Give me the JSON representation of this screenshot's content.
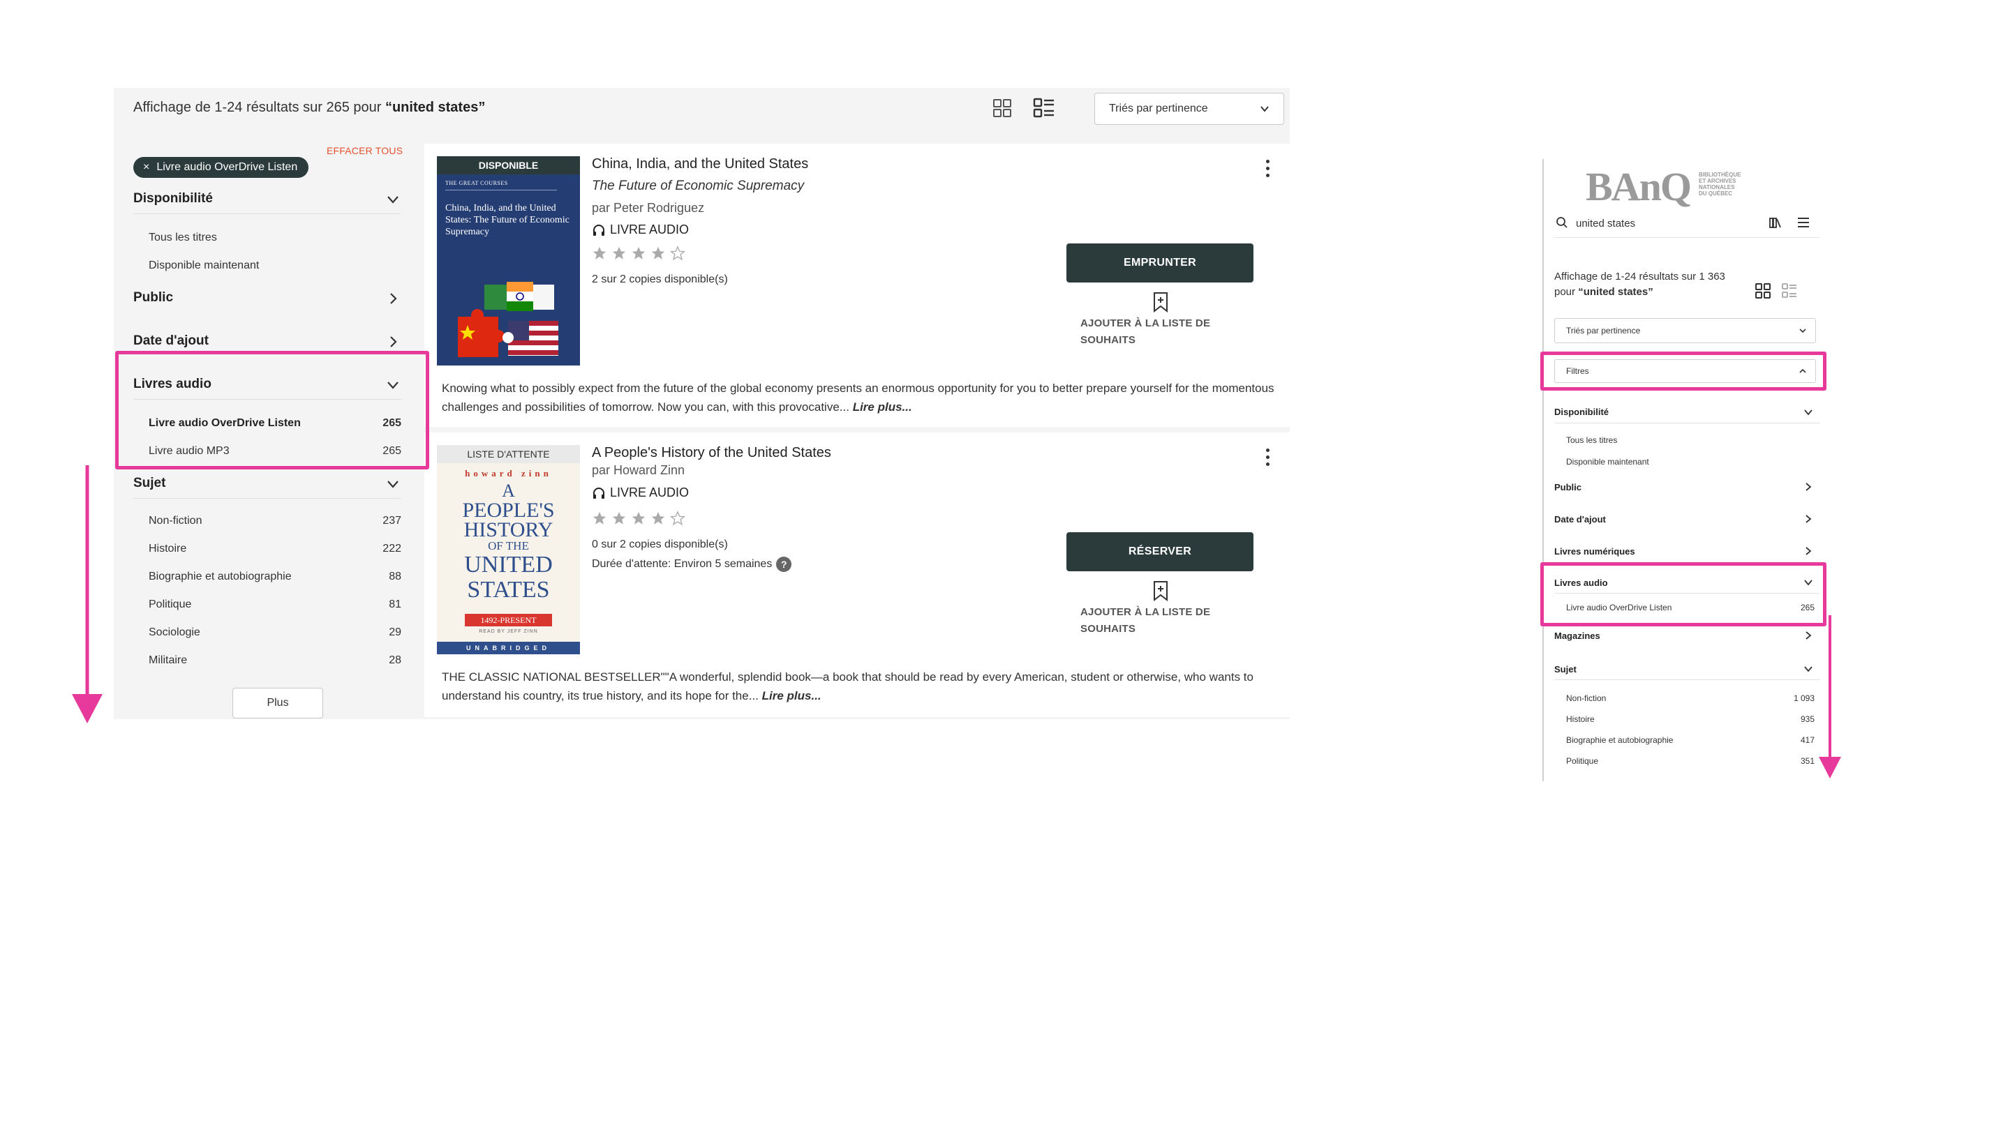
{
  "desktop": {
    "results_text": "Affichage de 1-24 résultats sur 265 pour ",
    "query_text": "“united states”",
    "sort_label": "Triés par pertinence",
    "active_filter": "Livre audio OverDrive Listen",
    "active_filter_remove": "×",
    "clear_all": "EFFACER TOUS",
    "sidebar": {
      "availability": {
        "title": "Disponibilité",
        "options": [
          "Tous les titres",
          "Disponible maintenant"
        ]
      },
      "audience": {
        "title": "Public"
      },
      "date_added": {
        "title": "Date d'ajout"
      },
      "audiobooks": {
        "title": "Livres audio",
        "options": [
          {
            "label": "Livre audio OverDrive Listen",
            "count": "265"
          },
          {
            "label": "Livre audio MP3",
            "count": "265"
          }
        ]
      },
      "subject": {
        "title": "Sujet",
        "options": [
          {
            "label": "Non-fiction",
            "count": "237"
          },
          {
            "label": "Histoire",
            "count": "222"
          },
          {
            "label": "Biographie et autobiographie",
            "count": "88"
          },
          {
            "label": "Politique",
            "count": "81"
          },
          {
            "label": "Sociologie",
            "count": "29"
          },
          {
            "label": "Militaire",
            "count": "28"
          }
        ]
      },
      "more_button": "Plus"
    },
    "books": [
      {
        "status": "DISPONIBLE",
        "cover_title": "China, India, and the United States: The Future of Economic Supremacy",
        "cover_publisher": "THE GREAT COURSES",
        "title": "China, India, and the United States",
        "subtitle": "The Future of Economic Supremacy",
        "author": "par Peter Rodriguez",
        "format": "LIVRE AUDIO",
        "rating": 4,
        "copies": "2 sur 2 copies disponible(s)",
        "action": "EMPRUNTER",
        "wishlist": "AJOUTER À LA LISTE DE SOUHAITS",
        "description": "Knowing what to possibly expect from the future of the global economy presents an enormous opportunity for you to better prepare yourself for the momentous challenges and possibilities of tomorrow. Now you can, with this provocative...",
        "read_more": "Lire plus..."
      },
      {
        "status": "LISTE D'ATTENTE",
        "cover_author": "howard zinn",
        "cover_lines": [
          "A",
          "PEOPLE'S",
          "HISTORY",
          "OF THE",
          "UNITED",
          "STATES"
        ],
        "cover_years": "1492-PRESENT",
        "cover_reader": "READ BY JEFF ZINN",
        "cover_footer": "UNABRIDGED",
        "title": "A People's History of the United States",
        "author": "par Howard Zinn",
        "format": "LIVRE AUDIO",
        "rating": 4,
        "copies": "0 sur 2 copies disponible(s)",
        "wait": "Durée d'attente: Environ 5 semaines",
        "wait_help": "?",
        "action": "RÉSERVER",
        "wishlist": "AJOUTER À LA LISTE DE SOUHAITS",
        "description": "THE CLASSIC NATIONAL BESTSELLER\"\"A wonderful, splendid book—a book that should be read by every American, student or otherwise, who wants to understand his country, its true history, and its hope for the...",
        "read_more": "Lire plus..."
      }
    ]
  },
  "mobile": {
    "logo_text": "BAnQ",
    "logo_sub": [
      "BIBLIOTHÈQUE",
      "ET ARCHIVES",
      "NATIONALES",
      "DU QUÉBEC"
    ],
    "search_value": "united states",
    "results_text": "Affichage de 1-24 résultats sur 1 363",
    "results_query_prefix": "pour ",
    "query_text": "“united states”",
    "sort_label": "Triés par pertinence",
    "filters_label": "Filtres",
    "availability": {
      "title": "Disponibilité",
      "options": [
        "Tous les titres",
        "Disponible maintenant"
      ]
    },
    "audience": "Public",
    "date_added": "Date d'ajout",
    "digital_books": "Livres numériques",
    "audiobooks": {
      "title": "Livres audio",
      "options": [
        {
          "label": "Livre audio OverDrive Listen",
          "count": "265"
        }
      ]
    },
    "magazines": "Magazines",
    "subject": {
      "title": "Sujet",
      "options": [
        {
          "label": "Non-fiction",
          "count": "1 093"
        },
        {
          "label": "Histoire",
          "count": "935"
        },
        {
          "label": "Biographie et autobiographie",
          "count": "417"
        },
        {
          "label": "Politique",
          "count": "351"
        }
      ]
    }
  },
  "colors": {
    "highlight": "#e6399b",
    "button_dark": "#2b3b3b",
    "clear_link": "#e4512f",
    "panel_bg": "#f4f4f4"
  }
}
